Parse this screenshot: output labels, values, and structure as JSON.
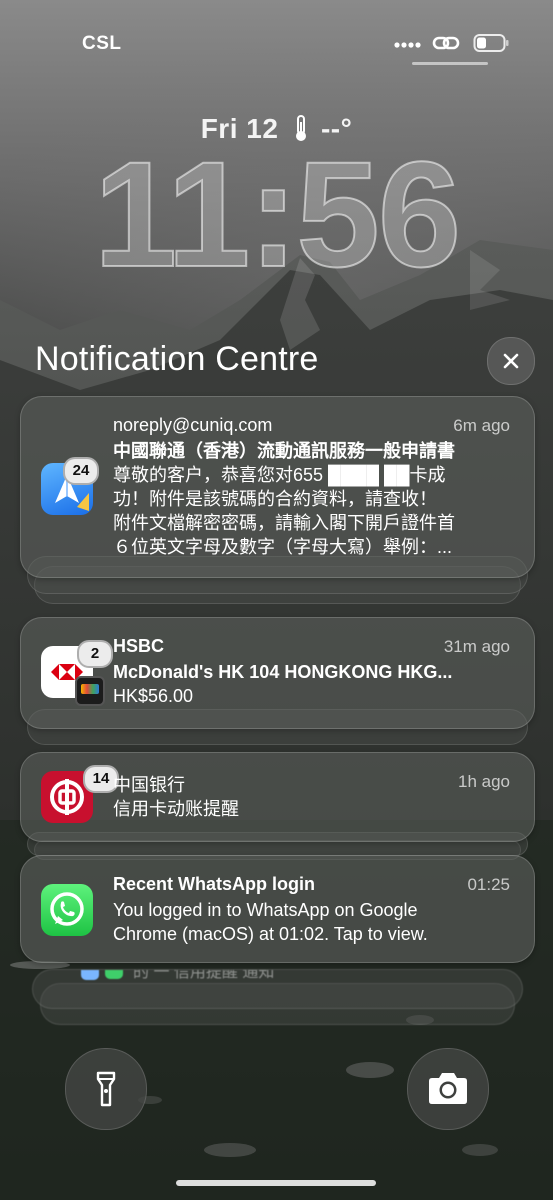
{
  "status_bar": {
    "carrier": "CSL"
  },
  "lock": {
    "date": "Fri 12",
    "temperature": "--°",
    "time": "11:56"
  },
  "notification_centre": {
    "title": "Notification Centre"
  },
  "notifications": [
    {
      "app": "mail",
      "badge": "24",
      "title": "noreply@cuniq.com",
      "time": "6m ago",
      "subject": "中國聯通（香港）流動通訊服務一般申請書",
      "body_lines": [
        "尊敬的客户，恭喜您对655 ████ ██卡成",
        "功！附件是該號碼的合約資料，請查收！",
        "附件文檔解密密碼，請輸入閣下開戶證件首",
        "６位英文字母及數字（字母大寫）舉例：..."
      ]
    },
    {
      "app": "HSBC",
      "badge": "2",
      "title": "HSBC",
      "time": "31m ago",
      "subject": "McDonald's HK 104 HONGKONG HKG...",
      "body": "HK$56.00"
    },
    {
      "app": "Bank of China",
      "badge": "14",
      "title": "中国银行",
      "time": "1h ago",
      "body": "信用卡动账提醒"
    },
    {
      "app": "WhatsApp",
      "title": "Recent WhatsApp login",
      "time": "01:25",
      "body_lines": [
        "You logged in to WhatsApp on Google",
        "Chrome (macOS) at 01:02. Tap to view."
      ]
    }
  ],
  "hidden_stack_peek": "的 一 信用提醒 通知"
}
